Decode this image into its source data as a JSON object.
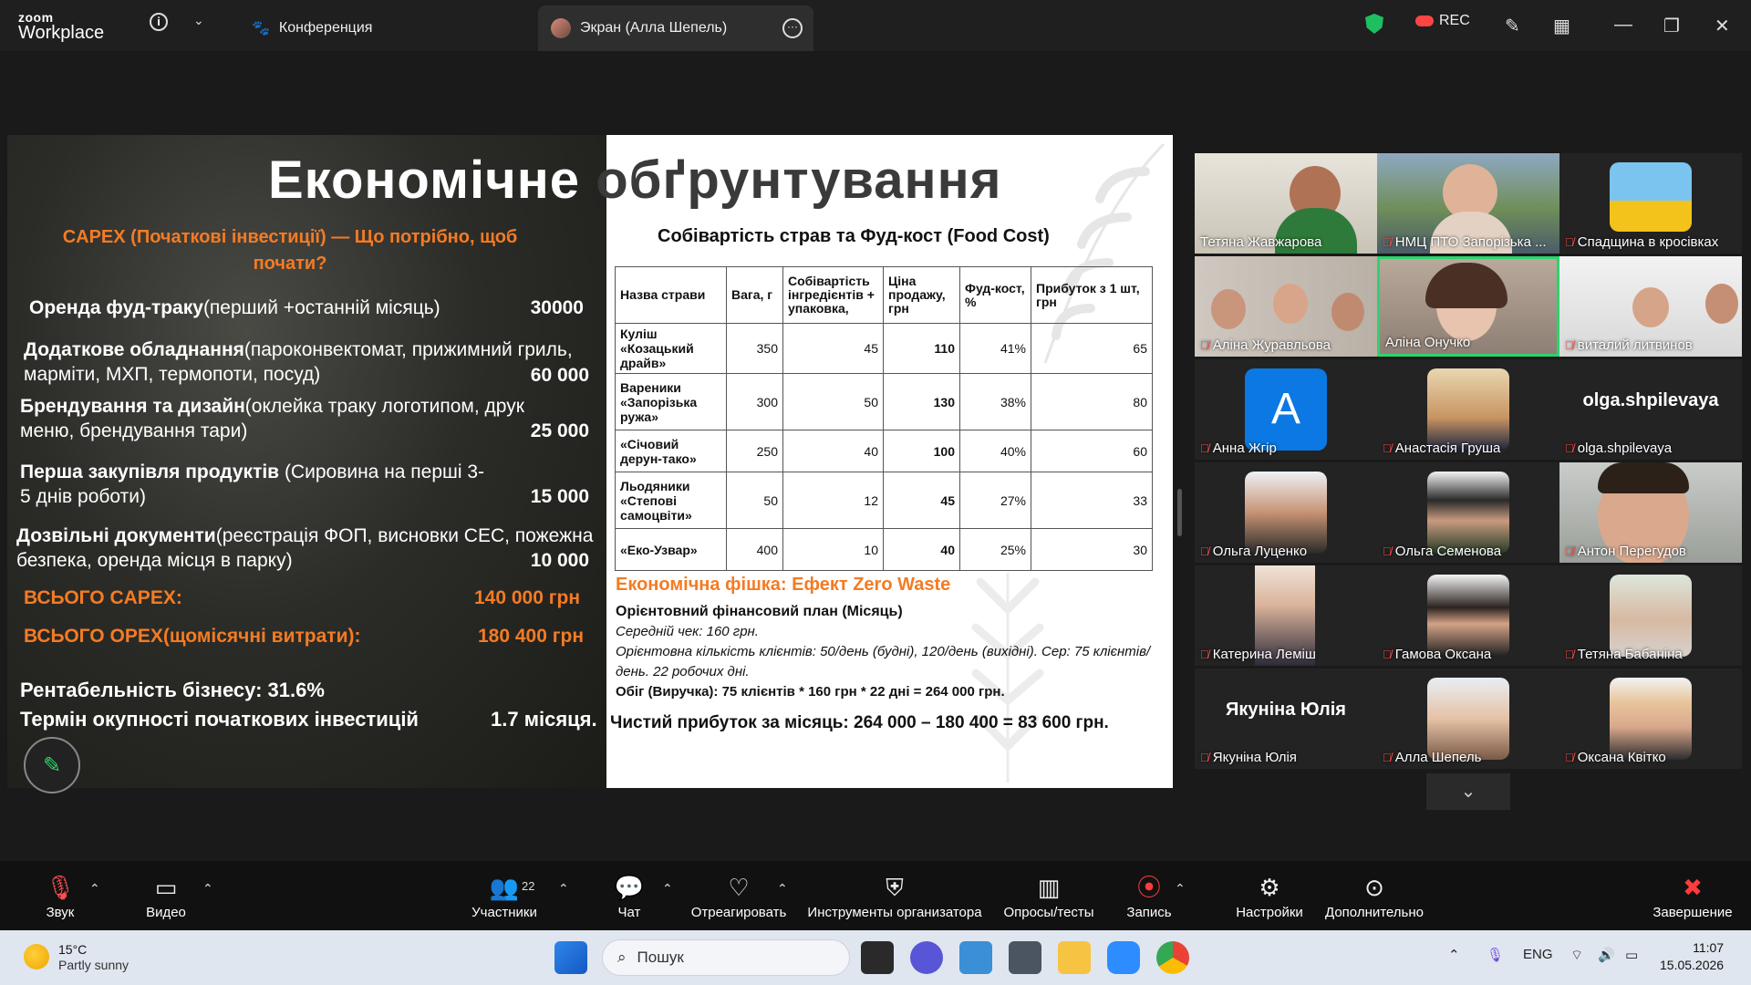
{
  "titlebar": {
    "logo_line1": "zoom",
    "logo_line2": "Workplace",
    "info_icon": "i",
    "tab_conference": "Конференция",
    "tab_screen": "Экран (Алла Шепель)",
    "rec_label": "REC",
    "colors": {
      "shield": "#1dbf60",
      "rec": "#ff4444"
    }
  },
  "slide": {
    "title_a": "Економічне",
    "title_b": "обґрунтування",
    "capex_heading": "CAPEX (Початкові інвестиції) — Що потрібно, щоб почати?",
    "items": [
      {
        "bold": "Оренда фуд-траку",
        "rest": "(перший +останній місяць)",
        "amount": "30000"
      },
      {
        "bold": "Додаткове обладнання",
        "rest": "(пароконвектомат, прижимний гриль, марміти, МХП, термопоти, посуд)",
        "amount": "60 000"
      },
      {
        "bold": "Брендування та дизайн",
        "rest": "(оклейка траку логотипом, друк меню, брендування тари)",
        "amount": "25 000"
      },
      {
        "bold": "Перша закупівля продуктів",
        "rest": " (Сировина на перші 3-5 днів роботи)",
        "amount": "15 000"
      },
      {
        "bold": "Дозвільні документи",
        "rest": "(реєстрація ФОП, висновки СЕС, пожежна безпека, оренда місця в парку)",
        "amount": "10 000"
      }
    ],
    "total_capex_label": "ВСЬОГО CAPEX:",
    "total_capex_value": "140 000 грн",
    "total_opex_label": "ВСЬОГО OPEX(щомісячні витрати):",
    "total_opex_value": "180 400 грн",
    "profitability": "Рентабельність бізнесу: 31.6%",
    "payback_label": "Термін окупності початкових інвестицій",
    "payback_value": "1.7 місяця.",
    "cost_title": "Собівартість страв та Фуд-кост (Food Cost)",
    "table_headers": [
      "Назва страви",
      "Вага, г",
      "Собівартість інгредієнтів + упаковка,",
      "Ціна продажу, грн",
      "Фуд-кост, %",
      "Прибуток з 1 шт, грн"
    ],
    "table_rows": [
      [
        "Куліш «Козацький драйв»",
        "350",
        "45",
        "110",
        "41%",
        "65"
      ],
      [
        "Вареники «Запорізька ружа»",
        "300",
        "50",
        "130",
        "38%",
        "80"
      ],
      [
        "«Січовий дерун-тако»",
        "250",
        "40",
        "100",
        "40%",
        "60"
      ],
      [
        "Льодяники «Степові самоцвіти»",
        "50",
        "12",
        "45",
        "27%",
        "33"
      ],
      [
        "«Еко-Узвар»",
        "400",
        "10",
        "40",
        "25%",
        "30"
      ]
    ],
    "zero_waste": "Економічна фішка: Ефект Zero Waste",
    "plan_title": "Орієнтовний фінансовий план (Місяць)",
    "avg_check": "Середній чек: 160 грн.",
    "clients": "Орієнтовна кількість клієнтів: 50/день (будні), 120/день (вихідні). Сер: 75 клієнтів/день. 22 робочих дні.",
    "revenue": "Обіг (Виручка): 75 клієнтів * 160 грн * 22 дні = 264 000 грн.",
    "net_profit": "Чистий прибуток за місяць: 264 000 – 180 400 = 83 600 грн.",
    "colors": {
      "accent": "#f47b24"
    }
  },
  "participants": [
    {
      "name": "Тетяна Жавжарова",
      "kind": "video"
    },
    {
      "name": "НМЦ ПТО Запорізька ...",
      "kind": "video"
    },
    {
      "name": "Спадщина в кросівках",
      "kind": "image"
    },
    {
      "name": "Аліна Журавльова",
      "kind": "video"
    },
    {
      "name": "Аліна Онучко",
      "kind": "video",
      "active": true
    },
    {
      "name": "виталий литвинов",
      "kind": "video"
    },
    {
      "name": "Анна Жгір",
      "kind": "letter",
      "letter": "A"
    },
    {
      "name": "Анастасія Груша",
      "kind": "image"
    },
    {
      "name": "olga.shpilevaya",
      "kind": "text",
      "display": "olga.shpilevaya"
    },
    {
      "name": "Ольга Луценко",
      "kind": "image"
    },
    {
      "name": "Ольга Семенова",
      "kind": "image"
    },
    {
      "name": "Антон Перегудов",
      "kind": "video"
    },
    {
      "name": "Катерина Леміш",
      "kind": "video"
    },
    {
      "name": "Гамова Оксана",
      "kind": "image"
    },
    {
      "name": "Тетяна Бабаніна",
      "kind": "image"
    },
    {
      "name": "Якуніна Юлія",
      "kind": "text",
      "display": "Якуніна Юлія"
    },
    {
      "name": "Алла Шепель",
      "kind": "image"
    },
    {
      "name": "Оксана Квітко",
      "kind": "image"
    }
  ],
  "toolbar": {
    "audio": "Звук",
    "video": "Видео",
    "participants": "Участники",
    "participants_count": "22",
    "chat": "Чат",
    "react": "Отреагировать",
    "host_tools": "Инструменты организатора",
    "polls": "Опросы/тесты",
    "record": "Запись",
    "settings": "Настройки",
    "more": "Дополнительно",
    "end": "Завершение"
  },
  "taskbar": {
    "temp": "15°C",
    "weather": "Partly sunny",
    "search_placeholder": "Пошук",
    "lang": "ENG",
    "time": "11:07",
    "date": "15.05.2026"
  }
}
